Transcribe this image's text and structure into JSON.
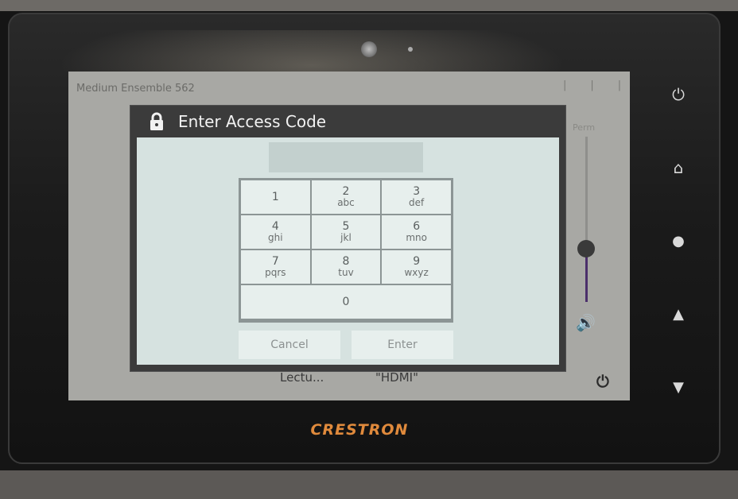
{
  "screen": {
    "room_title": "Medium Ensemble 562",
    "volume_label": "Perm",
    "source_label": "Lectu...",
    "input_label": "\"HDMI\""
  },
  "dialog": {
    "title": "Enter Access Code",
    "code_value": "",
    "keys": [
      {
        "num": "1",
        "letters": ""
      },
      {
        "num": "2",
        "letters": "abc"
      },
      {
        "num": "3",
        "letters": "def"
      },
      {
        "num": "4",
        "letters": "ghi"
      },
      {
        "num": "5",
        "letters": "jkl"
      },
      {
        "num": "6",
        "letters": "mno"
      },
      {
        "num": "7",
        "letters": "pqrs"
      },
      {
        "num": "8",
        "letters": "tuv"
      },
      {
        "num": "9",
        "letters": "wxyz"
      },
      {
        "num": "0",
        "letters": ""
      }
    ],
    "cancel_label": "Cancel",
    "enter_label": "Enter"
  },
  "hardware": {
    "brand": "CRESTRON",
    "icons": [
      "power-icon",
      "home-icon",
      "lightbulb-icon",
      "up-arrow-icon",
      "down-arrow-icon"
    ]
  },
  "colors": {
    "brand": "#e08a3c",
    "volume_fill": "#4b2f6b"
  },
  "volume_level": 0.33
}
